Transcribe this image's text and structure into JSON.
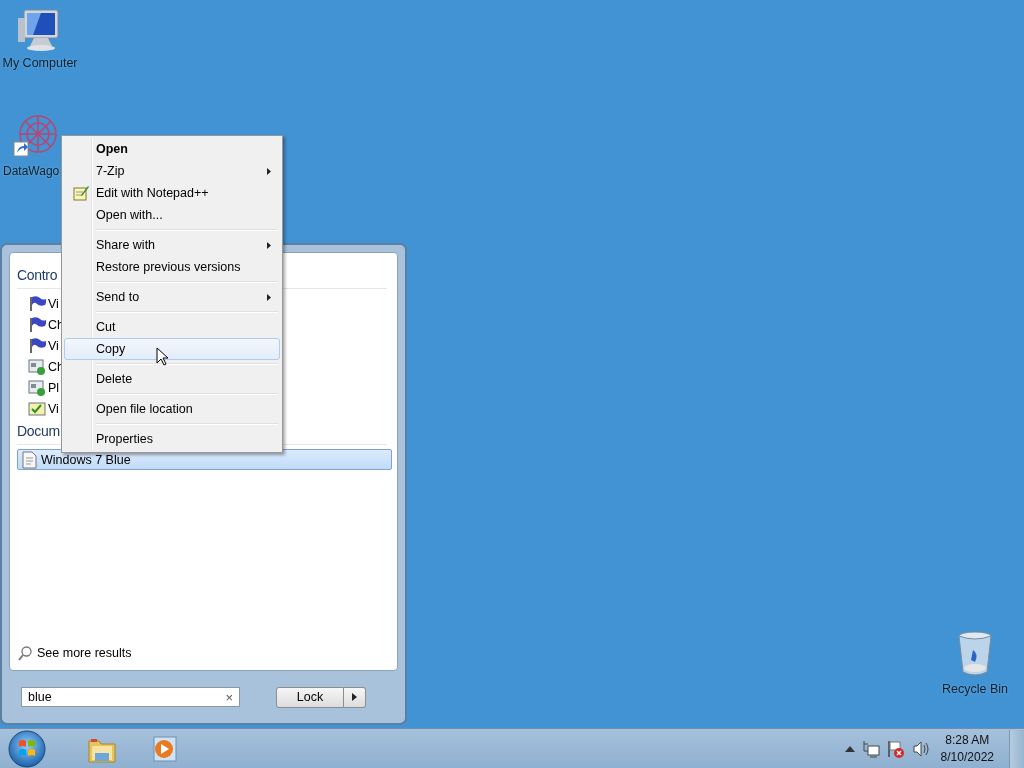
{
  "desktop_icons": [
    {
      "kind": "computer",
      "label": "My Computer"
    },
    {
      "kind": "shortcut",
      "label": "DataWago"
    },
    {
      "kind": "recycle",
      "label": "Recycle Bin"
    }
  ],
  "start_menu": {
    "sections": [
      {
        "heading": "Contro",
        "items": [
          {
            "kind": "flag",
            "label": "Vi",
            "selected": false
          },
          {
            "kind": "flag",
            "label": "Ch",
            "selected": false
          },
          {
            "kind": "flag",
            "label": "Vi",
            "selected": false
          },
          {
            "kind": "program",
            "label": "Ch",
            "selected": false
          },
          {
            "kind": "program",
            "label": "Pl",
            "selected": false
          },
          {
            "kind": "tasks",
            "label": "Vi",
            "selected": false
          }
        ]
      },
      {
        "heading": "Docum",
        "items": [
          {
            "kind": "document",
            "label": "Windows 7 Blue",
            "selected": true
          }
        ]
      }
    ],
    "see_more": "See more results",
    "search": {
      "value": "blue",
      "clear": "×"
    },
    "lock_button": "Lock"
  },
  "context_menu": [
    {
      "kind": "item",
      "label": "Open",
      "bold": true,
      "submenu": false,
      "selected": false
    },
    {
      "kind": "item",
      "label": "7-Zip",
      "bold": false,
      "submenu": true,
      "selected": false
    },
    {
      "kind": "notepad_item",
      "label": "Edit with Notepad++",
      "bold": false,
      "submenu": false,
      "selected": false
    },
    {
      "kind": "item",
      "label": "Open with...",
      "bold": false,
      "submenu": false,
      "selected": false
    },
    {
      "kind": "separator"
    },
    {
      "kind": "item",
      "label": "Share with",
      "bold": false,
      "submenu": true,
      "selected": false
    },
    {
      "kind": "item",
      "label": "Restore previous versions",
      "bold": false,
      "submenu": false,
      "selected": false
    },
    {
      "kind": "separator"
    },
    {
      "kind": "item",
      "label": "Send to",
      "bold": false,
      "submenu": true,
      "selected": false
    },
    {
      "kind": "separator"
    },
    {
      "kind": "item",
      "label": "Cut",
      "bold": false,
      "submenu": false,
      "selected": false
    },
    {
      "kind": "item",
      "label": "Copy",
      "bold": false,
      "submenu": false,
      "selected": true
    },
    {
      "kind": "separator"
    },
    {
      "kind": "item",
      "label": "Delete",
      "bold": false,
      "submenu": false,
      "selected": false
    },
    {
      "kind": "separator"
    },
    {
      "kind": "item",
      "label": "Open file location",
      "bold": false,
      "submenu": false,
      "selected": false
    },
    {
      "kind": "separator"
    },
    {
      "kind": "item",
      "label": "Properties",
      "bold": false,
      "submenu": false,
      "selected": false
    }
  ],
  "taskbar": {
    "pinned": [
      {
        "kind": "explorer"
      },
      {
        "kind": "media"
      }
    ],
    "clock": {
      "time": "8:28 AM",
      "date": "8/10/2022"
    }
  }
}
